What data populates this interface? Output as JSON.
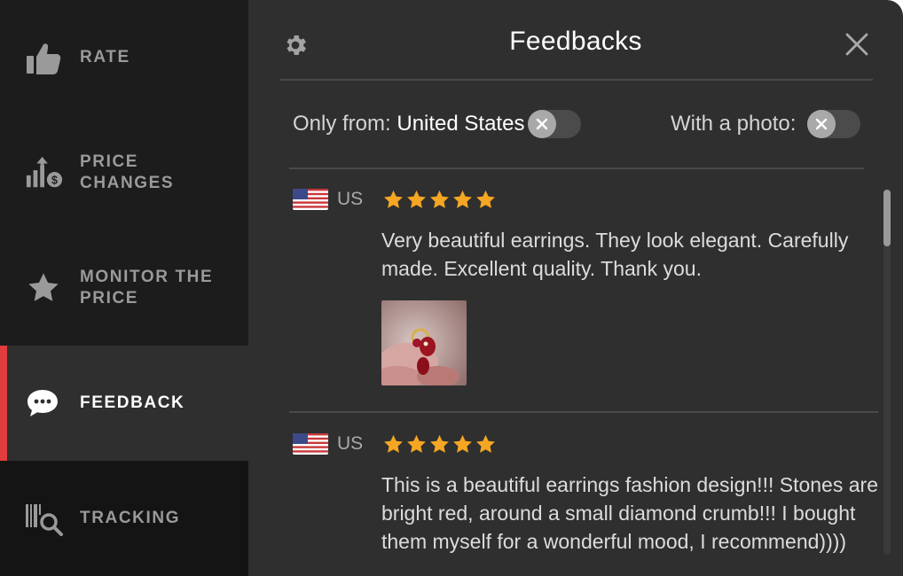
{
  "sidebar": {
    "items": [
      {
        "label": "RATE",
        "icon": "thumbs-up-icon"
      },
      {
        "label": "PRICE\nCHANGES",
        "icon": "price-chart-icon"
      },
      {
        "label": "MONITOR THE\nPRICE",
        "icon": "star-icon"
      },
      {
        "label": "FEEDBACK",
        "icon": "chat-bubble-icon",
        "active": true
      },
      {
        "label": "TRACKING",
        "icon": "barcode-search-icon"
      }
    ],
    "accent_color": "#e23c3c"
  },
  "header": {
    "title": "Feedbacks",
    "settings_icon": "gear-icon",
    "close_icon": "close-icon"
  },
  "filters": {
    "only_from_label": "Only from:",
    "only_from_value": "United States",
    "with_photo_label": "With a photo:"
  },
  "reviews": [
    {
      "country": "US",
      "rating": 5,
      "text": "Very beautiful earrings. They look elegant. Carefully made. Excellent quality. Thank you.",
      "has_photo": true
    },
    {
      "country": "US",
      "rating": 5,
      "text": "This is a beautiful earrings fashion design!!! Stones are bright red, around a small diamond crumb!!! I bought them myself for a wonderful mood, I recommend))))",
      "has_photo": false
    }
  ],
  "colors": {
    "star": "#f5a623",
    "background": "#2f2f2f",
    "sidebar": "#1c1c1c"
  }
}
